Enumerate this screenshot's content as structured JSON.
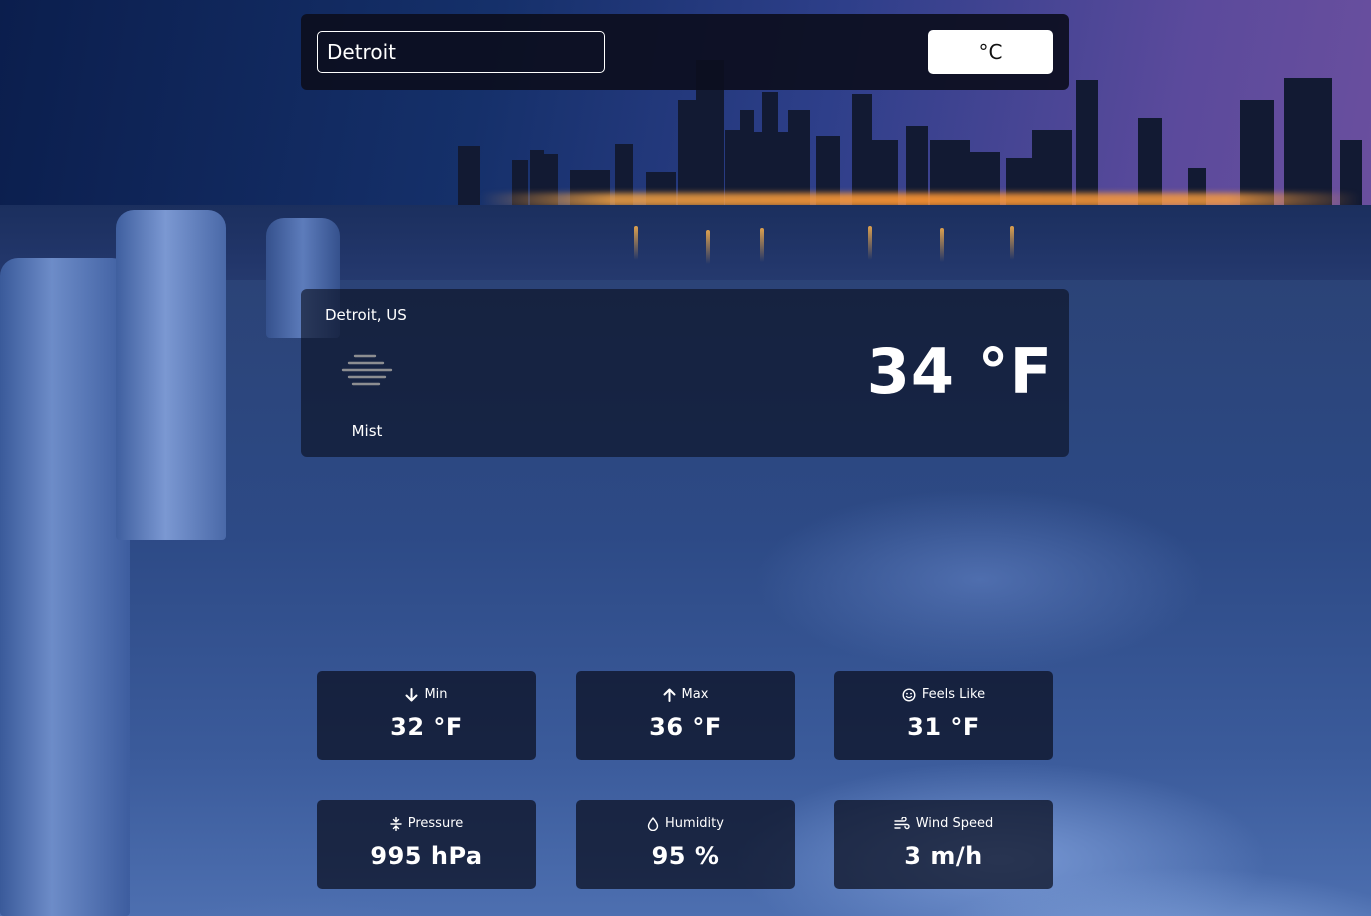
{
  "search": {
    "value": "Detroit"
  },
  "unit_toggle": {
    "label": "°C"
  },
  "current": {
    "location": "Detroit, US",
    "condition": "Mist",
    "condition_icon": "mist-icon",
    "temperature": "34 °F"
  },
  "stats": [
    {
      "label": "Min",
      "value": "32 °F",
      "icon": "arrow-down-icon"
    },
    {
      "label": "Max",
      "value": "36 °F",
      "icon": "arrow-up-icon"
    },
    {
      "label": "Feels Like",
      "value": "31 °F",
      "icon": "smiley-icon"
    },
    {
      "label": "Pressure",
      "value": "995 hPa",
      "icon": "pressure-icon"
    },
    {
      "label": "Humidity",
      "value": "95 %",
      "icon": "droplet-icon"
    },
    {
      "label": "Wind Speed",
      "value": "3 m/h",
      "icon": "wind-icon"
    }
  ],
  "colors": {
    "panel": "#0c0e1e",
    "text": "#ffffff",
    "button_bg": "#ffffff",
    "button_text": "#111111"
  }
}
